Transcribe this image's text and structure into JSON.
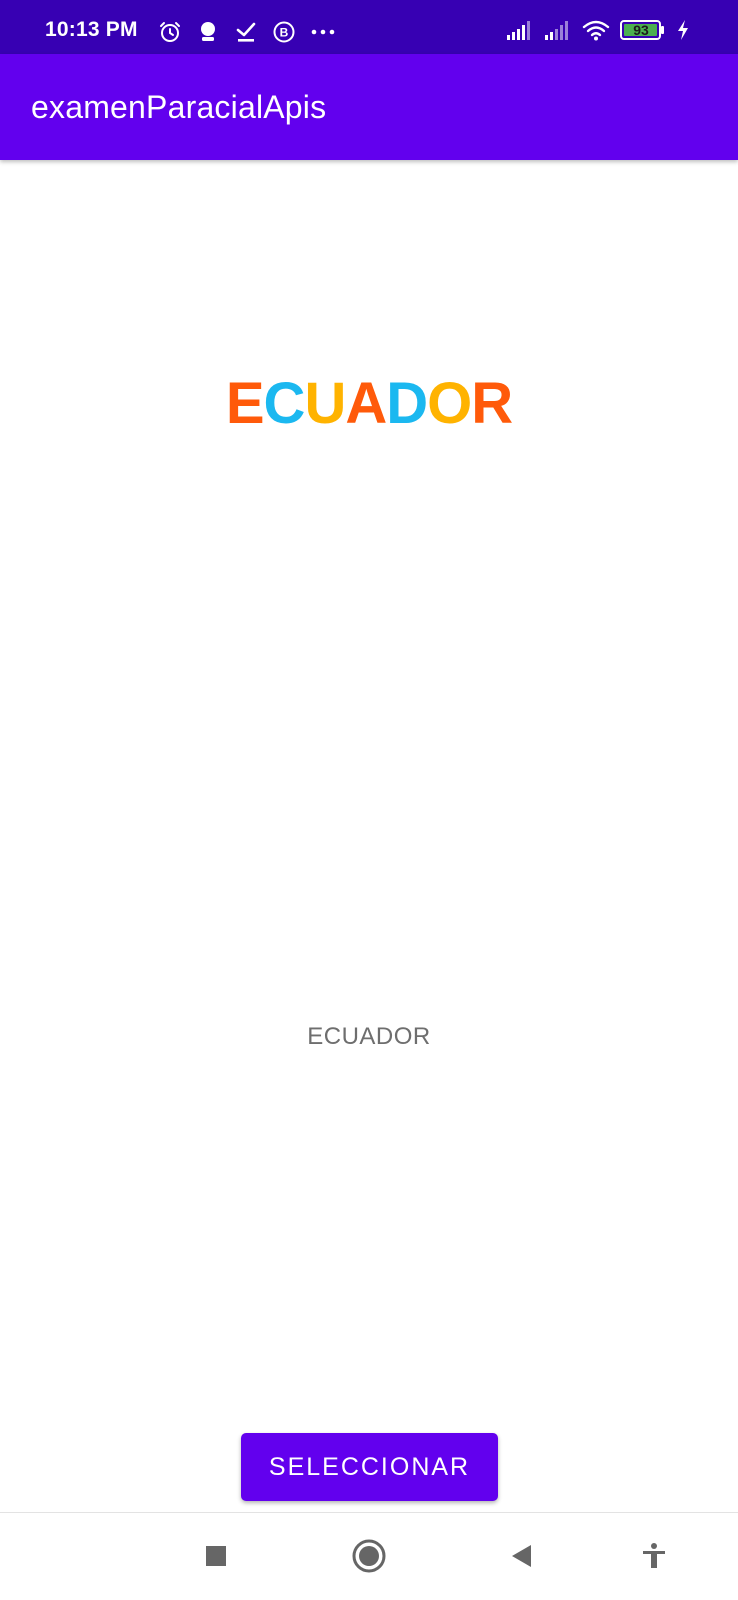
{
  "status_bar": {
    "time": "10:13 PM",
    "battery": "93",
    "left_icons": [
      "alarm-icon",
      "assistant-icon",
      "download-done-icon",
      "whatsapp-business-icon",
      "more-dots-icon"
    ],
    "right_icons": [
      "signal-icon",
      "signal-secondary-icon",
      "wifi-icon",
      "battery-icon",
      "charging-icon"
    ]
  },
  "app_bar": {
    "title": "examenParacialApis"
  },
  "logo": {
    "letters": [
      {
        "char": "E",
        "color": "#ff5a0a"
      },
      {
        "char": "C",
        "color": "#1bb8f0"
      },
      {
        "char": "U",
        "color": "#ffb300"
      },
      {
        "char": "A",
        "color": "#ff5a0a"
      },
      {
        "char": "D",
        "color": "#1bb8f0"
      },
      {
        "char": "O",
        "color": "#ffb300"
      },
      {
        "char": "R",
        "color": "#ff5a0a"
      }
    ]
  },
  "content": {
    "country_label": "ECUADOR"
  },
  "actions": {
    "select_label": "SELECCIONAR"
  },
  "nav_bar": {
    "items": [
      "recents-square-icon",
      "home-circle-icon",
      "back-triangle-icon",
      "accessibility-icon"
    ]
  },
  "colors": {
    "status_bar": "#3700b3",
    "primary": "#6200ee"
  }
}
